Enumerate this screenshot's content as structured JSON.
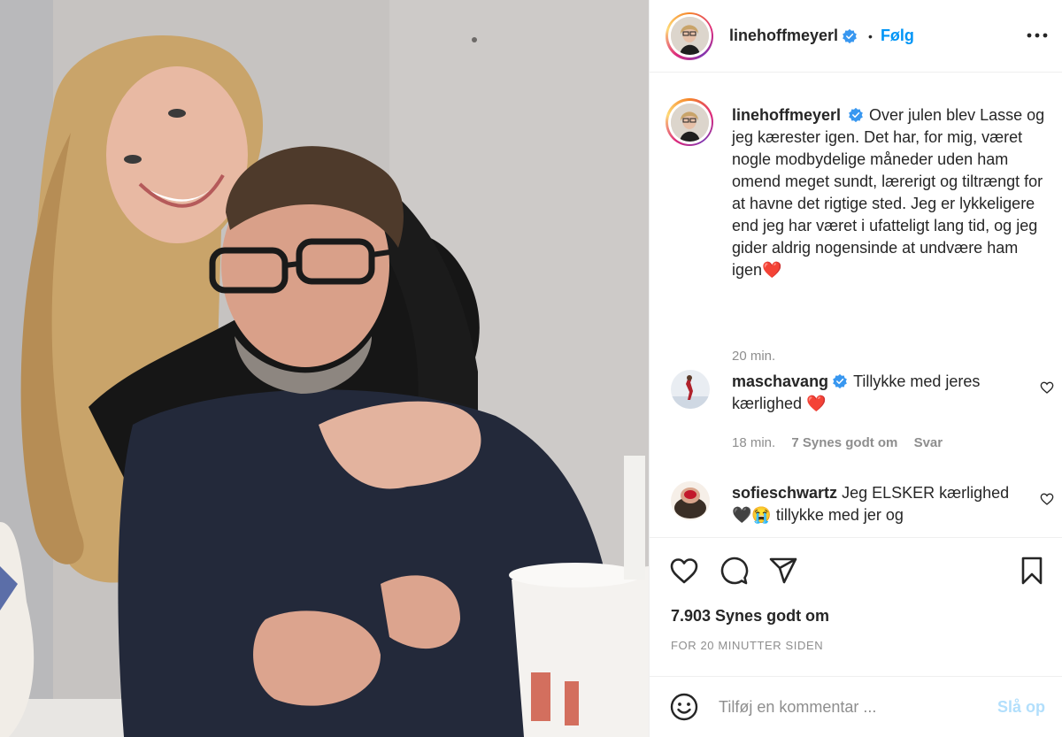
{
  "header": {
    "username": "linehoffmeyerl",
    "separator": "•",
    "follow_label": "Følg"
  },
  "caption": {
    "username": "linehoffmeyerl",
    "text": "Over julen blev Lasse og jeg kærester igen. Det har, for mig, været nogle modbydelige måneder uden ham omend meget sundt, lærerigt og tiltrængt for at havne det rigtige sted. Jeg er lykkeligere end jeg har været i ufatteligt lang tid, og jeg gider aldrig nogensinde at undvære ham igen❤️",
    "time": "20 min."
  },
  "comments": [
    {
      "username": "maschavang",
      "verified": true,
      "text": "Tillykke med jeres kærlighed ❤️",
      "time": "18 min.",
      "likes": "7 Synes godt om",
      "reply_label": "Svar"
    },
    {
      "username": "sofieschwartz",
      "verified": false,
      "text": "Jeg ELSKER kærlighed🖤😭 tillykke med jer og"
    }
  ],
  "actions": {
    "like_icon": "heart-icon",
    "comment_icon": "comment-icon",
    "share_icon": "share-icon",
    "save_icon": "bookmark-icon"
  },
  "likes_label": "7.903 Synes godt om",
  "timeago": "FOR 20 MINUTTER SIDEN",
  "add_comment": {
    "placeholder": "Tilføj en kommentar ...",
    "post_label": "Slå op"
  },
  "colors": {
    "link_blue": "#0095f6",
    "disabled_blue": "#b2dffc",
    "muted_text": "#8e8e8e",
    "verified_blue": "#3897f0"
  }
}
